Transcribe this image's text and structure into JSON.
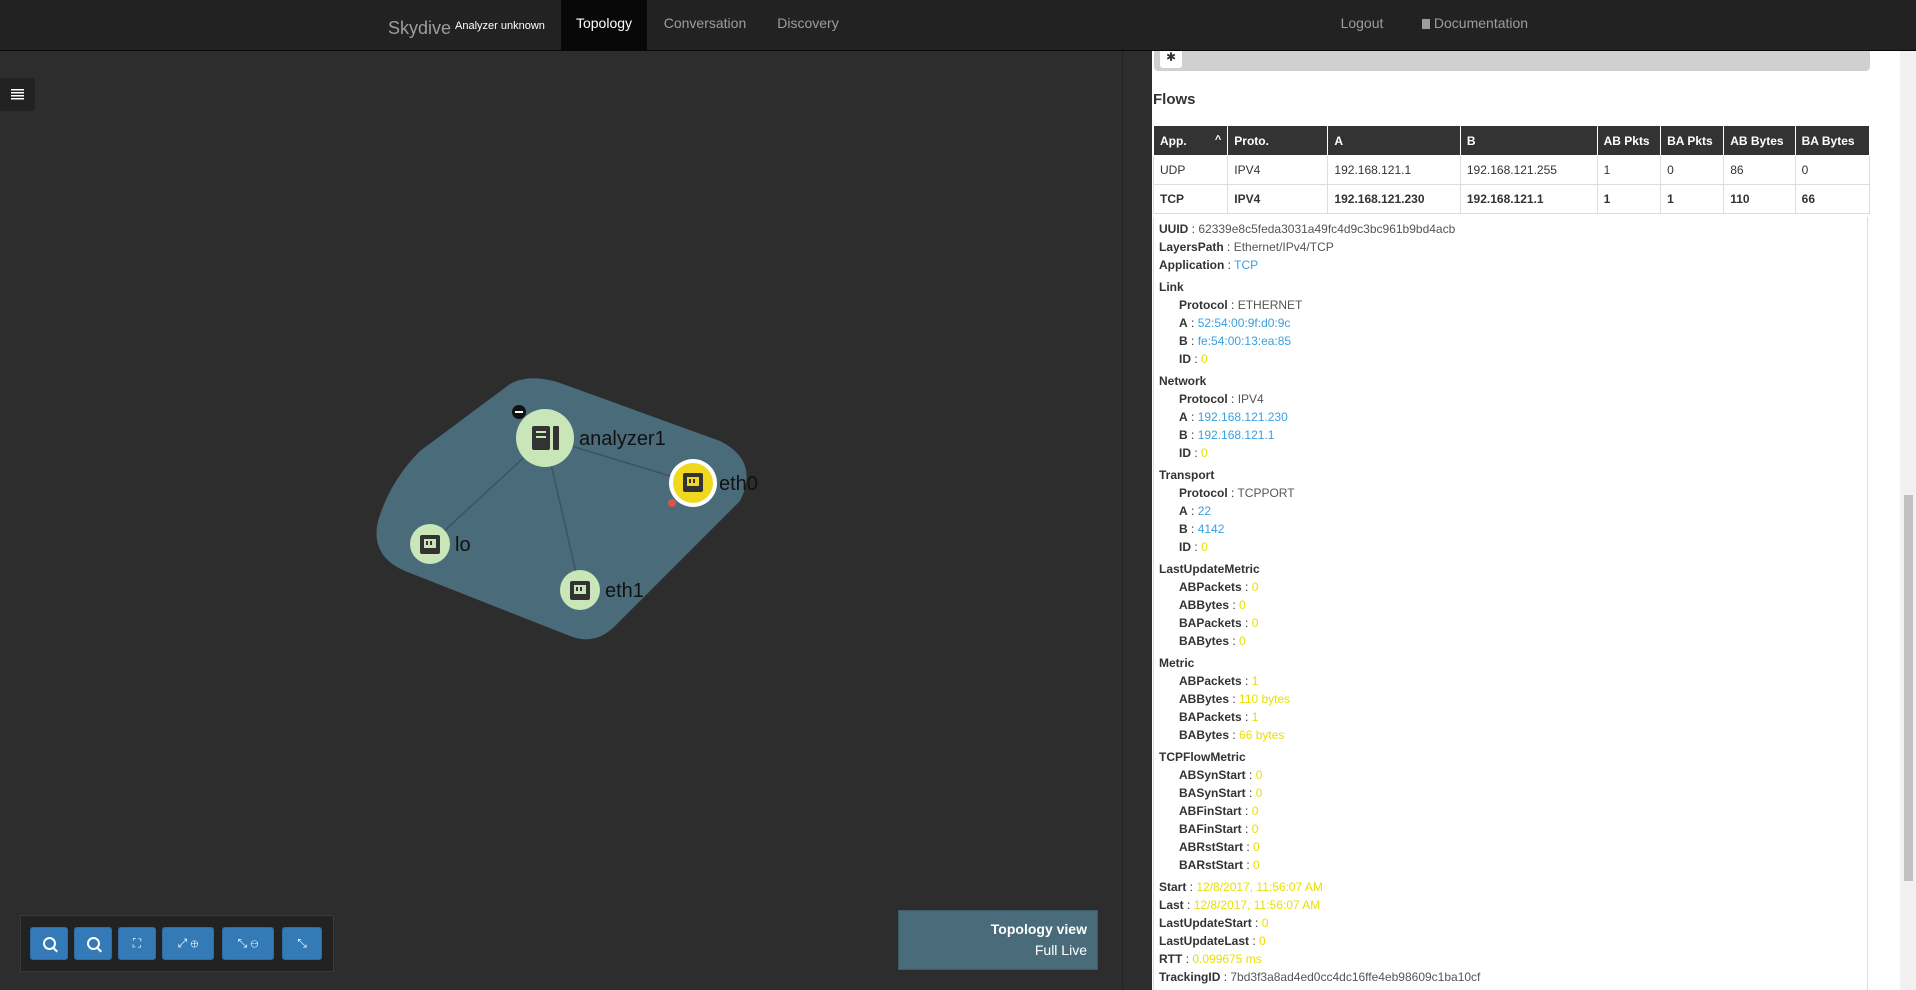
{
  "navbar": {
    "brand": "Skydive",
    "subtitle": "Analyzer unknown",
    "tabs": [
      {
        "label": "Topology",
        "active": true
      },
      {
        "label": "Conversation",
        "active": false
      },
      {
        "label": "Discovery",
        "active": false
      }
    ],
    "logout": "Logout",
    "documentation": "Documentation",
    "documentation_icon": "book-icon"
  },
  "topology": {
    "nodes": [
      {
        "label": "analyzer1",
        "icon": "server-icon",
        "state": "collapse-toggle"
      },
      {
        "label": "eth0",
        "icon": "ethernet-icon",
        "highlighted": true
      },
      {
        "label": "lo",
        "icon": "ethernet-icon"
      },
      {
        "label": "eth1",
        "icon": "ethernet-icon"
      }
    ],
    "group_color": "#4a6c7a",
    "toolbar": [
      "zoom-in-icon",
      "zoom-out-icon",
      "zoom-fit-icon",
      "expand-icon",
      "collapse-icon",
      "compress-icon"
    ],
    "view_title": "Topology view",
    "view_mode": "Full Live"
  },
  "flows": {
    "title": "Flows",
    "columns": [
      "App.",
      "Proto.",
      "A",
      "B",
      "AB Pkts",
      "BA Pkts",
      "AB Bytes",
      "BA Bytes"
    ],
    "rows": [
      [
        "UDP",
        "IPV4",
        "192.168.121.1",
        "192.168.121.255",
        "1",
        "0",
        "86",
        "0"
      ],
      [
        "TCP",
        "IPV4",
        "192.168.121.230",
        "192.168.121.1",
        "1",
        "1",
        "110",
        "66"
      ]
    ]
  },
  "details": {
    "uuid": {
      "key": "UUID",
      "value": "62339e8c5feda3031a49fc4d9c3bc961b9bd4acb"
    },
    "layers_path": {
      "key": "LayersPath",
      "value": "Ethernet/IPv4/TCP"
    },
    "application": {
      "key": "Application",
      "value": "TCP"
    },
    "link": {
      "title": "Link",
      "protocol": "ETHERNET",
      "a": "52:54:00:9f:d0:9c",
      "b": "fe:54:00:13:ea:85",
      "id": "0"
    },
    "network": {
      "title": "Network",
      "protocol": "IPV4",
      "a": "192.168.121.230",
      "b": "192.168.121.1",
      "id": "0"
    },
    "transport": {
      "title": "Transport",
      "protocol": "TCPPORT",
      "a": "22",
      "b": "4142",
      "id": "0"
    },
    "last_update_metric": {
      "title": "LastUpdateMetric",
      "ab_packets": "0",
      "ab_bytes": "0",
      "ba_packets": "0",
      "ba_bytes": "0"
    },
    "metric": {
      "title": "Metric",
      "ab_packets": "1",
      "ab_bytes": "110 bytes",
      "ba_packets": "1",
      "ba_bytes": "66 bytes"
    },
    "tcp_flow_metric": {
      "title": "TCPFlowMetric",
      "ab_syn_start": "0",
      "ba_syn_start": "0",
      "ab_fin_start": "0",
      "ba_fin_start": "0",
      "ab_rst_start": "0",
      "ba_rst_start": "0"
    },
    "labels": {
      "protocol": "Protocol",
      "a": "A",
      "b": "B",
      "id": "ID",
      "ab_packets": "ABPackets",
      "ab_bytes": "ABBytes",
      "ba_packets": "BAPackets",
      "ba_bytes": "BABytes",
      "ab_syn_start": "ABSynStart",
      "ba_syn_start": "BASynStart",
      "ab_fin_start": "ABFinStart",
      "ba_fin_start": "BAFinStart",
      "ab_rst_start": "ABRstStart",
      "ba_rst_start": "BARstStart",
      "start": "Start",
      "last": "Last",
      "last_update_start": "LastUpdateStart",
      "last_update_last": "LastUpdateLast",
      "rtt": "RTT",
      "tracking_id": "TrackingID"
    },
    "start": "12/8/2017, 11:56:07 AM",
    "last": "12/8/2017, 11:56:07 AM",
    "last_update_start": "0",
    "last_update_last": "0",
    "rtt": "0.099675 ms",
    "tracking_id": "7bd3f3a8ad4ed0cc4dc16ffe4eb98609c1ba10cf"
  }
}
